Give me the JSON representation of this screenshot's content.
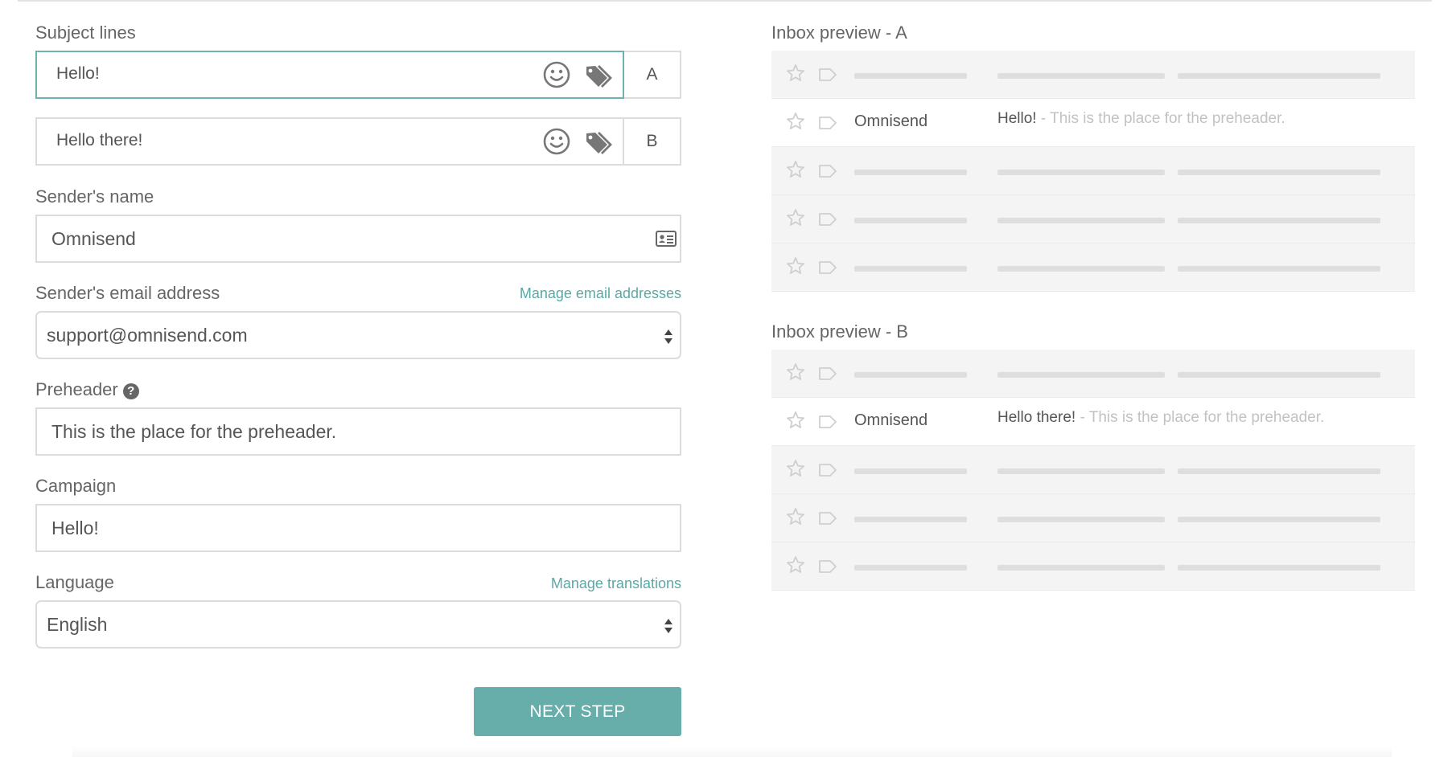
{
  "form": {
    "subject_lines_label": "Subject lines",
    "subject_a": {
      "value": "Hello!",
      "variant": "A"
    },
    "subject_b": {
      "value": "Hello there!",
      "variant": "B"
    },
    "sender_name_label": "Sender's name",
    "sender_name_value": "Omnisend",
    "sender_email_label": "Sender's email address",
    "manage_emails_link": "Manage email addresses",
    "sender_email_value": "support@omnisend.com",
    "preheader_label": "Preheader",
    "preheader_help": "?",
    "preheader_value": "This is the place for the preheader.",
    "campaign_label": "Campaign",
    "campaign_value": "Hello!",
    "language_label": "Language",
    "manage_translations_link": "Manage translations",
    "language_value": "English",
    "next_button": "NEXT STEP"
  },
  "preview_a": {
    "title": "Inbox preview - A",
    "sender": "Omnisend",
    "subject": "Hello!",
    "preheader": " - This is the place for the preheader."
  },
  "preview_b": {
    "title": "Inbox preview - B",
    "sender": "Omnisend",
    "subject": "Hello there!",
    "preheader": " - This is the place for the preheader."
  },
  "icons": {
    "emoji": "smile-icon",
    "personalization": "tags-icon",
    "contact_card": "id-card-icon",
    "select": "sort-arrows-icon",
    "star": "star-icon",
    "label": "label-tag-icon",
    "help": "question-circle-icon"
  },
  "colors": {
    "accent": "#67aeab",
    "link": "#5ba8a4",
    "focus_border": "#6db3ad",
    "placeholder_bar": "#dedede",
    "preview_row_bg": "#f4f4f4"
  }
}
